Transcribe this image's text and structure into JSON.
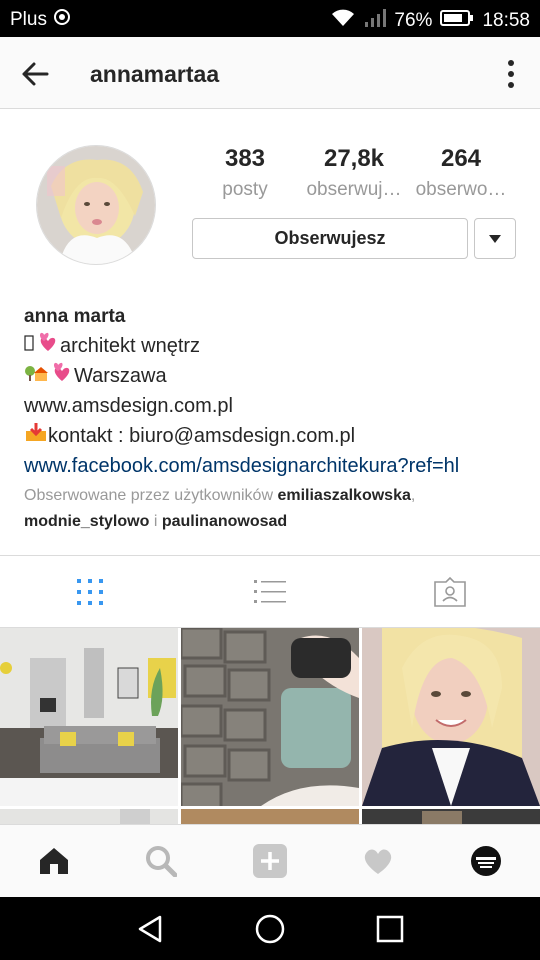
{
  "status_bar": {
    "carrier": "Plus",
    "battery": "76%",
    "time": "18:58"
  },
  "header": {
    "username": "annamartaa"
  },
  "stats": [
    {
      "count": "383",
      "label": "posty"
    },
    {
      "count": "27,8k",
      "label": "obserwuj…"
    },
    {
      "count": "264",
      "label": "obserwo…"
    }
  ],
  "follow_button": "Obserwujesz",
  "bio": {
    "name": "anna marta",
    "line1": "architekt wnętrz",
    "line2": "Warszawa",
    "website": "www.amsdesign.com.pl",
    "contact": "kontakt : biuro@amsdesign.com.pl",
    "facebook": "www.facebook.com/amsdesignarchitekura?ref=hl"
  },
  "followed_by": {
    "prefix": "Obserwowane przez użytkowników",
    "user1": "emiliaszalkowska",
    "sep1": ",",
    "user2": "modnie_stylowo",
    "sep2": "i",
    "user3": "paulinanowosad"
  },
  "tabs": [
    "grid-icon",
    "list-icon",
    "tagged-icon"
  ],
  "colors": {
    "accent": "#3897f0",
    "link": "#003569",
    "muted": "#999999",
    "text": "#262626"
  }
}
